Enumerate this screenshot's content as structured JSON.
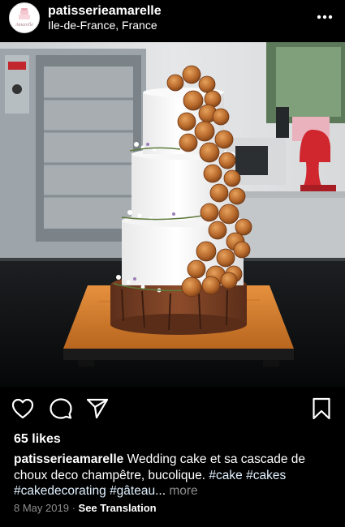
{
  "post": {
    "username": "patisserieamarelle",
    "location": "Ile-de-France, France",
    "avatar_text": "Amarelle",
    "likes": "65 likes",
    "caption_user": "patisserieamarelle",
    "caption_text_1": "Wedding cake et sa cascade de choux deco champêtre, bucolique.",
    "tag_1": "#cake",
    "tag_2": "#cakes",
    "tag_3": "#cakedecorating",
    "tag_4": "#gâteau",
    "ellipsis": "...",
    "more_label": "more",
    "date": "8 May 2019",
    "separator": "·",
    "see_translation": "See Translation"
  },
  "icons": {
    "more": "more-options-icon",
    "like": "heart-icon",
    "comment": "comment-icon",
    "share": "share-icon",
    "save": "bookmark-icon"
  },
  "colors": {
    "background": "#000000",
    "text": "#ffffff",
    "hashtag": "#e0f1ff",
    "muted": "#8e8e8e"
  }
}
